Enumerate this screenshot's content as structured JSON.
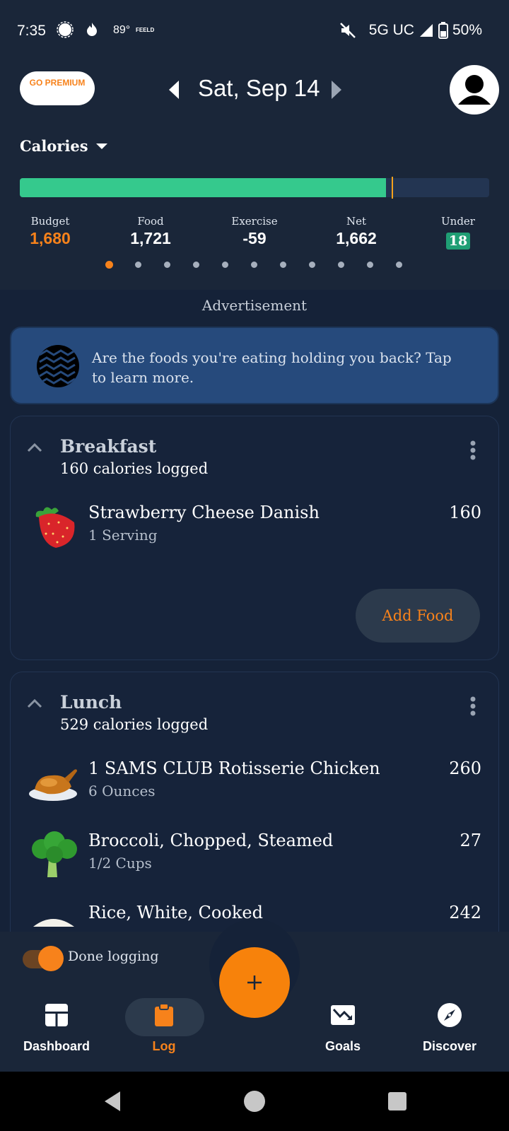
{
  "status_bar": {
    "time": "7:35",
    "temp": "89°",
    "app_tag": "FEELD",
    "network": "5G UC",
    "battery": "50%"
  },
  "header": {
    "premium_label": "GO PREMIUM",
    "date": "Sat, Sep 14"
  },
  "calories": {
    "title": "Calories",
    "progress_fraction": 0.78,
    "stats": [
      {
        "label": "Budget",
        "value": "1,680"
      },
      {
        "label": "Food",
        "value": "1,721"
      },
      {
        "label": "Exercise",
        "value": "-59"
      },
      {
        "label": "Net",
        "value": "1,662"
      },
      {
        "label": "Under",
        "value": "18"
      }
    ],
    "page_count": 11,
    "active_page": 0
  },
  "ad": {
    "label": "Advertisement",
    "text": "Are the foods you're eating holding you back? Tap to learn more."
  },
  "meals": [
    {
      "name": "Breakfast",
      "logged": "160 calories logged",
      "foods": [
        {
          "name": "Strawberry Cheese Danish",
          "serving": "1 Serving",
          "calories": "160",
          "icon": "strawberry-icon"
        }
      ],
      "add_label": "Add Food"
    },
    {
      "name": "Lunch",
      "logged": "529 calories logged",
      "foods": [
        {
          "name": "1 SAMS CLUB Rotisserie Chicken",
          "serving": "6 Ounces",
          "calories": "260",
          "icon": "chicken-icon"
        },
        {
          "name": "Broccoli, Chopped, Steamed",
          "serving": "1/2 Cups",
          "calories": "27",
          "icon": "broccoli-icon"
        },
        {
          "name": "Rice, White, Cooked",
          "serving": "",
          "calories": "242",
          "icon": "rice-icon"
        }
      ]
    }
  ],
  "done_logging": {
    "label": "Done logging"
  },
  "nav": {
    "items": [
      {
        "label": "Dashboard",
        "icon": "dashboard-icon"
      },
      {
        "label": "Log",
        "icon": "clipboard-icon"
      },
      {
        "label": "Goals",
        "icon": "goals-chart-icon"
      },
      {
        "label": "Discover",
        "icon": "compass-icon"
      }
    ]
  },
  "colors": {
    "accent": "#f7821b",
    "progress": "#35c98d",
    "background": "#152238"
  }
}
